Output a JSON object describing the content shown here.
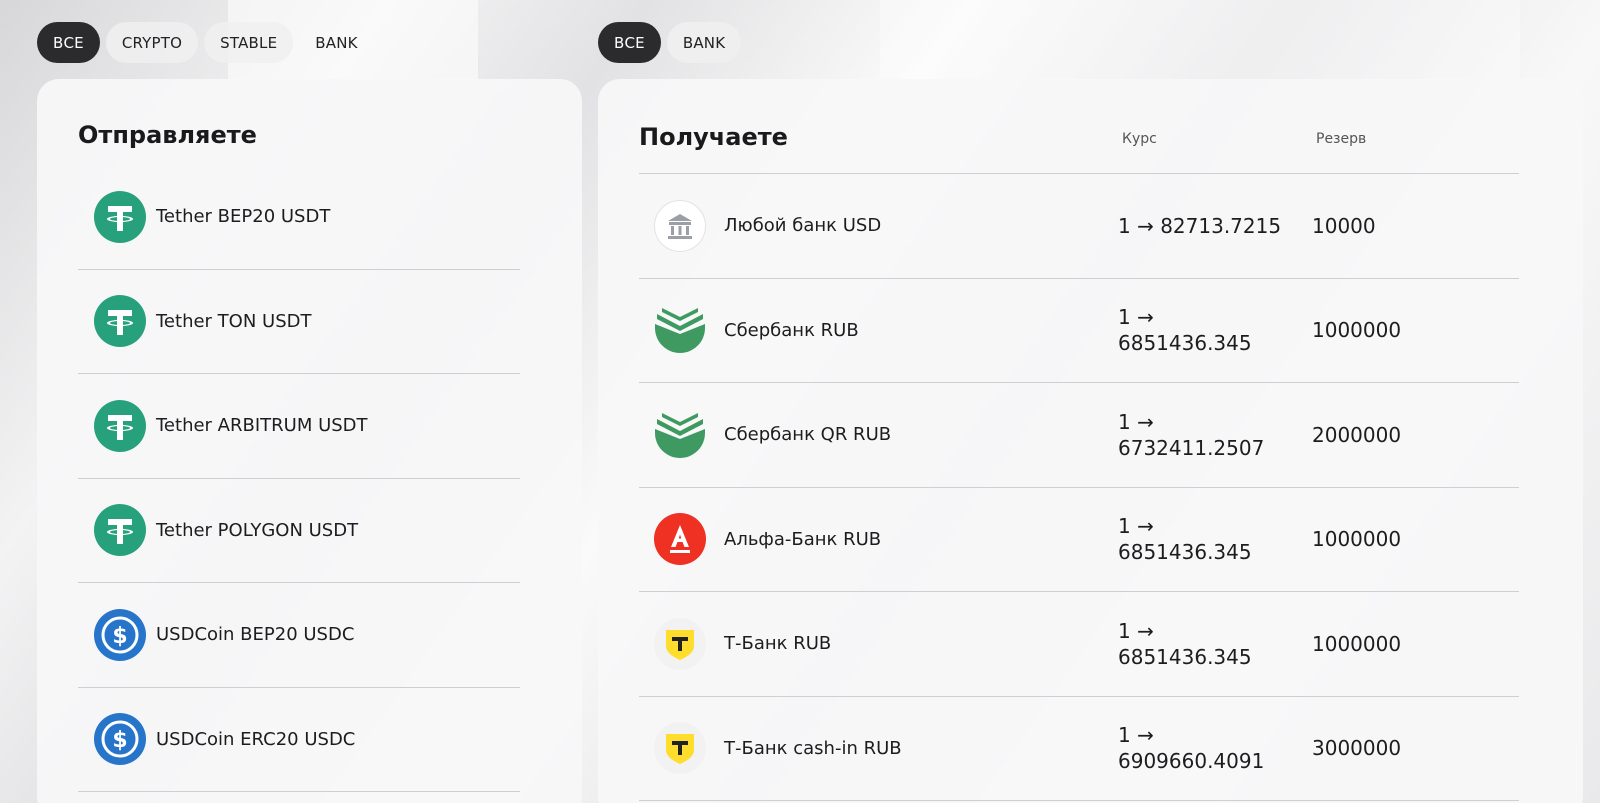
{
  "send_filters": [
    {
      "label": "ВСЕ",
      "active": true
    },
    {
      "label": "CRYPTO",
      "active": false
    },
    {
      "label": "STABLE",
      "active": false
    },
    {
      "label": "BANK",
      "active": false
    }
  ],
  "recv_filters": [
    {
      "label": "ВСЕ",
      "active": true
    },
    {
      "label": "BANK",
      "active": false
    }
  ],
  "send": {
    "title": "Отправляете",
    "items": [
      {
        "label": "Tether BEP20 USDT",
        "icon": "tether-icon"
      },
      {
        "label": "Tether TON USDT",
        "icon": "tether-icon"
      },
      {
        "label": "Tether ARBITRUM USDT",
        "icon": "tether-icon"
      },
      {
        "label": "Tether POLYGON USDT",
        "icon": "tether-icon"
      },
      {
        "label": "USDCoin BEP20 USDC",
        "icon": "usdc-icon"
      },
      {
        "label": "USDCoin ERC20 USDC",
        "icon": "usdc-icon"
      }
    ]
  },
  "recv": {
    "title": "Получаете",
    "col_rate": "Курс",
    "col_reserve": "Резерв",
    "items": [
      {
        "label": "Любой банк USD",
        "rate_prefix": "1 →",
        "rate_value": "82713.7215",
        "reserve": "10000",
        "icon": "bank-building-icon"
      },
      {
        "label": "Сбербанк RUB",
        "rate_prefix": "1 →",
        "rate_value": "6851436.345",
        "reserve": "1000000",
        "icon": "sberbank-icon"
      },
      {
        "label": "Сбербанк QR RUB",
        "rate_prefix": "1 →",
        "rate_value": "6732411.2507",
        "reserve": "2000000",
        "icon": "sberbank-icon"
      },
      {
        "label": "Альфа-Банк RUB",
        "rate_prefix": "1 →",
        "rate_value": "6851436.345",
        "reserve": "1000000",
        "icon": "alfa-bank-icon"
      },
      {
        "label": "Т-Банк RUB",
        "rate_prefix": "1 →",
        "rate_value": "6851436.345",
        "reserve": "1000000",
        "icon": "t-bank-icon"
      },
      {
        "label": "Т-Банк cash-in RUB",
        "rate_prefix": "1 →",
        "rate_value": "6909660.4091",
        "reserve": "3000000",
        "icon": "t-bank-icon"
      }
    ]
  },
  "colors": {
    "tether": "#26a17b",
    "usdc": "#2775ca",
    "sber": "#21a038",
    "alfa": "#ef3124",
    "tbank": "#ffdd2d",
    "active_chip": "#2b2b2d"
  }
}
